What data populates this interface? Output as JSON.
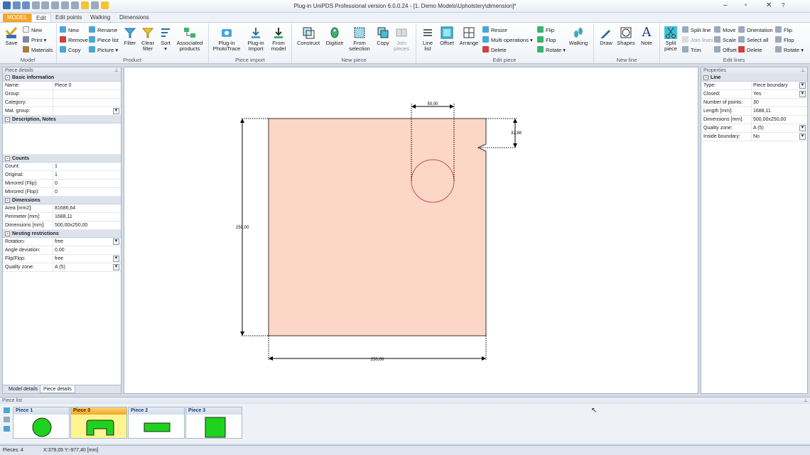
{
  "window": {
    "title": "Plug-in UniPDS Professional version 6.0.0.24 - [1. Demo Models\\Upholstery\\dimension]*"
  },
  "tabs": [
    "MODEL",
    "Edit",
    "Edit points",
    "Walking",
    "Dimensions"
  ],
  "ribbon": {
    "model": {
      "save": "Save",
      "new": "New",
      "print": "Print",
      "materials": "Materials",
      "label": "Model"
    },
    "product": {
      "new": "New",
      "remove": "Remove",
      "copy": "Copy",
      "rename": "Rename",
      "piece_list": "Piece list",
      "picture": "Picture",
      "filter": "Filter",
      "clear_filter_1": "Clear",
      "clear_filter_2": "filter",
      "sort": "Sort",
      "assoc_1": "Associated",
      "assoc_2": "products",
      "label": "Product"
    },
    "piece_import": {
      "phototrace_1": "Plug-in",
      "phototrace_2": "PhotoTrace",
      "import_1": "Plug-in",
      "import_2": "Import",
      "from_model_1": "From",
      "from_model_2": "model",
      "label": "Piece import"
    },
    "new_piece": {
      "construct": "Construct",
      "digitize": "Digitize",
      "from_sel_1": "From",
      "from_sel_2": "selection",
      "copy": "Copy",
      "join_1": "Join",
      "join_2": "pieces",
      "label": "New piece"
    },
    "edit_piece": {
      "line_list_1": "Line",
      "line_list_2": "list",
      "offset": "Offset",
      "arrange": "Arrange",
      "resize": "Resize",
      "multi_ops": "Multi operations",
      "delete": "Delete",
      "flip": "Flip",
      "flop": "Flop",
      "rotate": "Rotate",
      "walking": "Walking",
      "label": "Edit piece"
    },
    "new_line": {
      "draw": "Draw",
      "shapes": "Shapes",
      "note": "Note",
      "label": "New line"
    },
    "edit_lines": {
      "split_piece_1": "Split",
      "split_piece_2": "piece",
      "split_line": "Split line",
      "join_lines": "Join lines",
      "trim": "Trim",
      "move": "Move",
      "scale": "Scale",
      "offset": "Offset",
      "orientation": "Orientation",
      "select_all": "Select all",
      "delete": "Delete",
      "flip": "Flip",
      "flop": "Flop",
      "rotate": "Rotate",
      "label": "Edit lines"
    }
  },
  "piece_details": {
    "title": "Piece details",
    "basic_title": "Basic information",
    "basic": [
      {
        "k": "Name:",
        "v": "Piece 0"
      },
      {
        "k": "Group:",
        "v": ""
      },
      {
        "k": "Category:",
        "v": ""
      },
      {
        "k": "Mat. group:",
        "v": ""
      }
    ],
    "desc_title": "Description, Notes",
    "counts_title": "Counts",
    "counts": [
      {
        "k": "Count:",
        "v": "1"
      },
      {
        "k": "Original:",
        "v": "1"
      },
      {
        "k": "Mirrored (Flip):",
        "v": "0"
      },
      {
        "k": "Mirrored (Flop):",
        "v": "0"
      }
    ],
    "dims_title": "Dimensions",
    "dims": [
      {
        "k": "Area [mm2]:",
        "v": "81686,64"
      },
      {
        "k": "Perimeter [mm]:",
        "v": "1688,11"
      },
      {
        "k": "Dimensions [mm]:",
        "v": "500,00x250,00"
      }
    ],
    "nest_title": "Nesting restrictions",
    "nest": [
      {
        "k": "Rotation:",
        "v": "free"
      },
      {
        "k": "Angle deviation:",
        "v": "0,00"
      },
      {
        "k": "Flip/Flop:",
        "v": "free"
      },
      {
        "k": "Quality zone:",
        "v": "A (5)"
      }
    ],
    "bottom_tabs": [
      "Model details",
      "Piece details"
    ]
  },
  "properties": {
    "title": "Properties",
    "section": "Line",
    "rows": [
      {
        "k": "Type:",
        "v": "Piece boundary"
      },
      {
        "k": "Closed:",
        "v": "Yes"
      },
      {
        "k": "Number of points:",
        "v": "30"
      },
      {
        "k": "Length [mm]:",
        "v": "1688,11"
      },
      {
        "k": "Dimensions [mm]:",
        "v": "500,00x250,00"
      },
      {
        "k": "Quality zone:",
        "v": "A (5)"
      },
      {
        "k": "Inside boundary:",
        "v": "No"
      }
    ]
  },
  "drawing": {
    "dim_top": "50,00",
    "dim_right": "32,88",
    "dim_left": "250,00",
    "dim_bottom": "250,00",
    "piece_color": "#fcd6c6"
  },
  "piece_list": {
    "title": "Piece list",
    "pieces": [
      "Piece 1",
      "Piece 0",
      "Piece 2",
      "Piece 3"
    ],
    "selected": "Piece 0"
  },
  "status": {
    "pieces": "Pieces: 4",
    "coords": "X:379,05  Y:-977,40 [mm]"
  }
}
